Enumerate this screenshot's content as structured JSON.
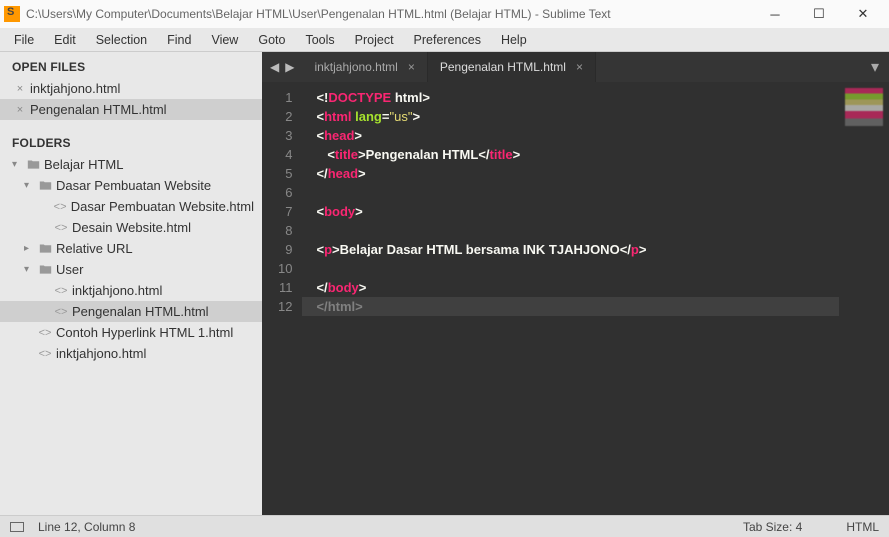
{
  "titlebar": {
    "path": "C:\\Users\\My Computer\\Documents\\Belajar HTML\\User\\Pengenalan HTML.html (Belajar HTML) - Sublime Text"
  },
  "menu": [
    "File",
    "Edit",
    "Selection",
    "Find",
    "View",
    "Goto",
    "Tools",
    "Project",
    "Preferences",
    "Help"
  ],
  "sidebar": {
    "open_hdr": "OPEN FILES",
    "open_files": [
      {
        "name": "inktjahjono.html",
        "active": false
      },
      {
        "name": "Pengenalan HTML.html",
        "active": true
      }
    ],
    "folders_hdr": "FOLDERS",
    "tree": [
      {
        "indent": 0,
        "type": "folder",
        "name": "Belajar HTML",
        "expanded": true
      },
      {
        "indent": 1,
        "type": "folder",
        "name": "Dasar Pembuatan Website",
        "expanded": true
      },
      {
        "indent": 2,
        "type": "file",
        "name": "Dasar Pembuatan Website.html"
      },
      {
        "indent": 2,
        "type": "file",
        "name": "Desain Website.html"
      },
      {
        "indent": 1,
        "type": "folder",
        "name": "Relative URL",
        "expanded": false
      },
      {
        "indent": 1,
        "type": "folder",
        "name": "User",
        "expanded": true
      },
      {
        "indent": 2,
        "type": "file",
        "name": "inktjahjono.html"
      },
      {
        "indent": 2,
        "type": "file",
        "name": "Pengenalan HTML.html",
        "selected": true
      },
      {
        "indent": 1,
        "type": "file",
        "name": "Contoh Hyperlink HTML 1.html"
      },
      {
        "indent": 1,
        "type": "file",
        "name": "inktjahjono.html"
      }
    ]
  },
  "tabs": [
    {
      "label": "inktjahjono.html",
      "active": false
    },
    {
      "label": "Pengenalan HTML.html",
      "active": true
    }
  ],
  "code": {
    "line_count": 12,
    "lines": [
      [
        {
          "t": "<!",
          "c": "c-white"
        },
        {
          "t": "DOCTYPE",
          "c": "c-red"
        },
        {
          "t": " ",
          "c": "c-white"
        },
        {
          "t": "html",
          "c": "c-white"
        },
        {
          "t": ">",
          "c": "c-white"
        }
      ],
      [
        {
          "t": "<",
          "c": "c-white"
        },
        {
          "t": "html",
          "c": "c-red"
        },
        {
          "t": " ",
          "c": ""
        },
        {
          "t": "lang",
          "c": "c-green"
        },
        {
          "t": "=",
          "c": "c-white"
        },
        {
          "t": "\"us\"",
          "c": "c-yellow"
        },
        {
          "t": ">",
          "c": "c-white"
        }
      ],
      [
        {
          "t": "<",
          "c": "c-white"
        },
        {
          "t": "head",
          "c": "c-red"
        },
        {
          "t": ">",
          "c": "c-white"
        }
      ],
      [
        {
          "t": "   ",
          "c": ""
        },
        {
          "t": "<",
          "c": "c-white"
        },
        {
          "t": "title",
          "c": "c-red"
        },
        {
          "t": ">",
          "c": "c-white"
        },
        {
          "t": "Pengenalan HTML",
          "c": "c-white"
        },
        {
          "t": "</",
          "c": "c-white"
        },
        {
          "t": "title",
          "c": "c-red"
        },
        {
          "t": ">",
          "c": "c-white"
        }
      ],
      [
        {
          "t": "</",
          "c": "c-white"
        },
        {
          "t": "head",
          "c": "c-red"
        },
        {
          "t": ">",
          "c": "c-white"
        }
      ],
      [],
      [
        {
          "t": "<",
          "c": "c-white"
        },
        {
          "t": "body",
          "c": "c-red"
        },
        {
          "t": ">",
          "c": "c-white"
        }
      ],
      [],
      [
        {
          "t": "<",
          "c": "c-white"
        },
        {
          "t": "p",
          "c": "c-red"
        },
        {
          "t": ">",
          "c": "c-white"
        },
        {
          "t": "Belajar Dasar HTML bersama INK TJAHJONO",
          "c": "c-white"
        },
        {
          "t": "</",
          "c": "c-white"
        },
        {
          "t": "p",
          "c": "c-red"
        },
        {
          "t": ">",
          "c": "c-white"
        }
      ],
      [],
      [
        {
          "t": "</",
          "c": "c-white"
        },
        {
          "t": "body",
          "c": "c-red"
        },
        {
          "t": ">",
          "c": "c-white"
        }
      ],
      [
        {
          "t": "</",
          "c": "c-gray"
        },
        {
          "t": "html",
          "c": "c-gray"
        },
        {
          "t": ">",
          "c": "c-gray"
        }
      ]
    ],
    "selected_line": 12
  },
  "status": {
    "cursor": "Line 12, Column 8",
    "tabsize": "Tab Size: 4",
    "lang": "HTML"
  }
}
